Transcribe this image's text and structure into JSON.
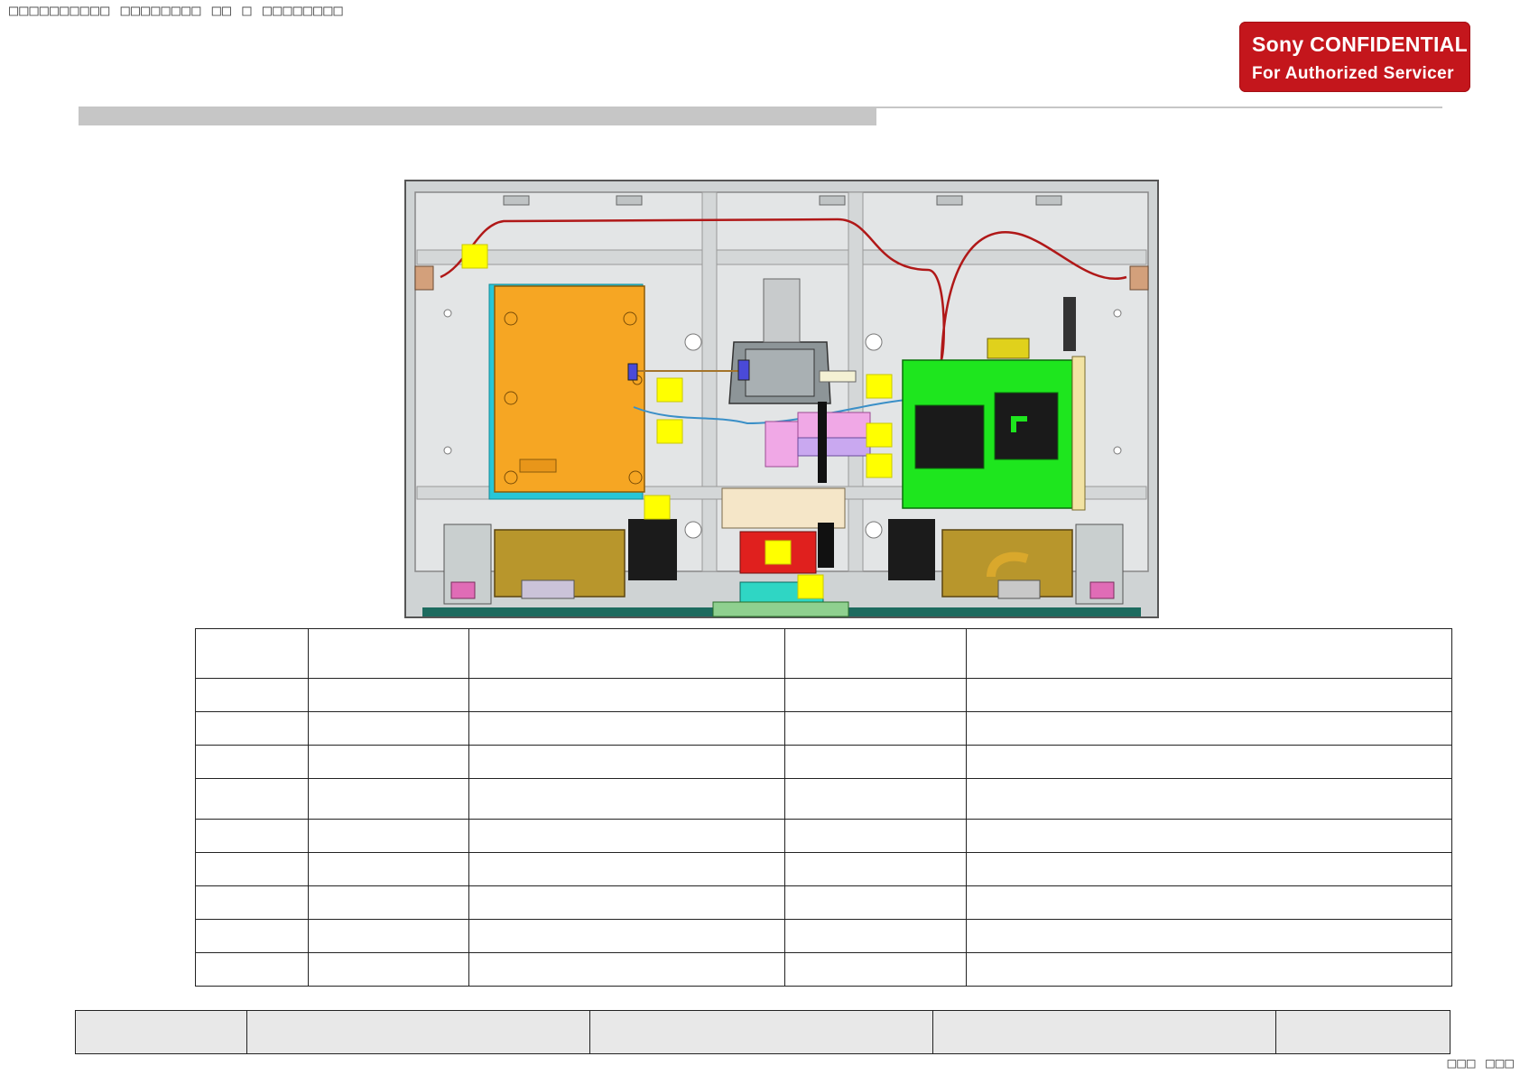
{
  "header": {
    "garbled_title": "□□□□□□□□□□ □□□□□□□□ □□ □ □□□□□□□□"
  },
  "badge": {
    "line1": "Sony CONFIDENTIAL",
    "line2": "For Authorized Servicer"
  },
  "colors": {
    "badge_red": "#c4161c",
    "power_board_orange": "#f6a623",
    "main_board_green": "#1ee61e",
    "callout_yellow": "#ffff00",
    "chassis_gray": "#d9d9d9",
    "speaker_gold": "#b8962c",
    "base_teal": "#1d6b5f"
  },
  "diagram": {
    "callouts": [
      "",
      "",
      "",
      "",
      "",
      "",
      "",
      "",
      ""
    ],
    "components": [
      "power-board",
      "main-board",
      "tuner-bracket",
      "speaker-left",
      "speaker-right",
      "bottom-center-bracket",
      "ir-sensor-board"
    ]
  },
  "parts_table": {
    "headers": [
      "",
      "",
      "",
      "",
      ""
    ],
    "rows": [
      [
        "",
        "",
        "",
        "",
        ""
      ],
      [
        "",
        "",
        "",
        "",
        ""
      ],
      [
        "",
        "",
        "",
        "",
        ""
      ],
      [
        "",
        "",
        "",
        "",
        ""
      ],
      [
        "",
        "",
        "",
        "",
        ""
      ],
      [
        "",
        "",
        "",
        "",
        ""
      ],
      [
        "",
        "",
        "",
        "",
        ""
      ],
      [
        "",
        "",
        "",
        "",
        ""
      ],
      [
        "",
        "",
        "",
        "",
        ""
      ]
    ]
  },
  "summary_row": [
    "",
    "",
    "",
    "",
    ""
  ],
  "footer": {
    "page_number": "□□□ □□□"
  }
}
